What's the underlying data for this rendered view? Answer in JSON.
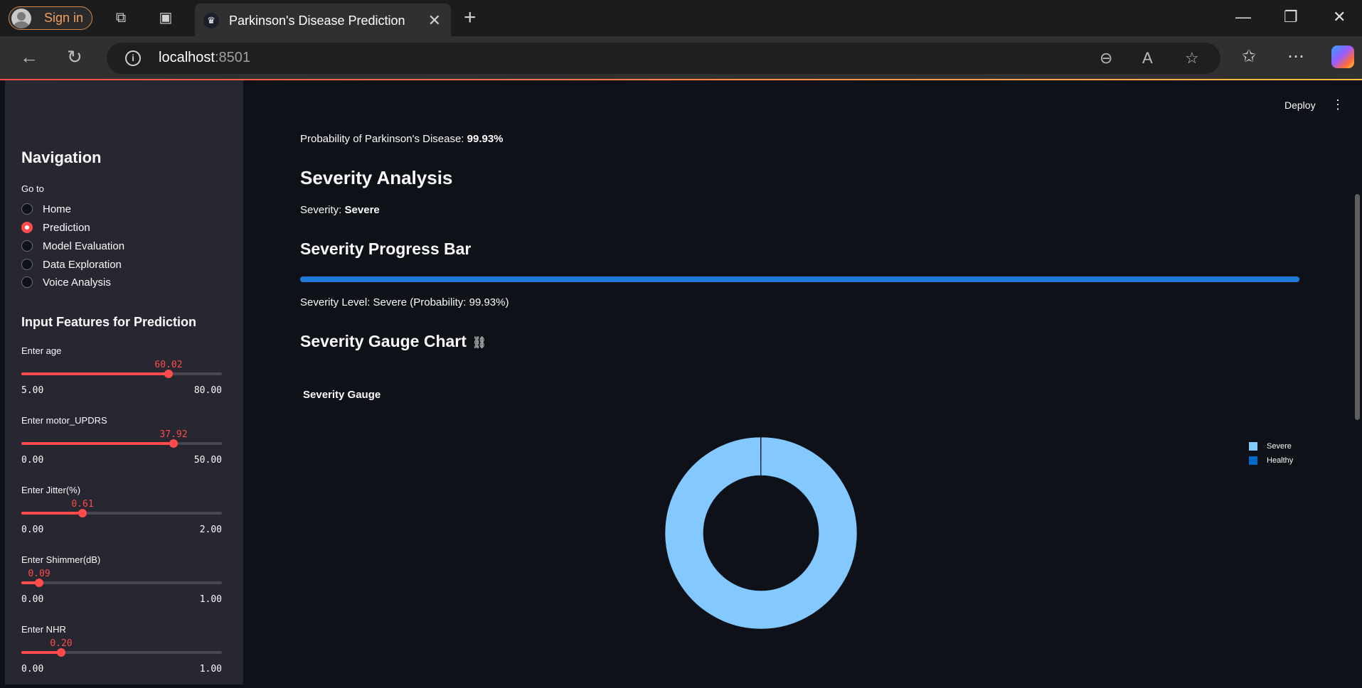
{
  "browser": {
    "signin_label": "Sign in",
    "tab_title": "Parkinson's Disease Prediction",
    "url_host": "localhost",
    "url_port": ":8501"
  },
  "sidebar": {
    "nav_title": "Navigation",
    "goto_label": "Go to",
    "nav_options": [
      {
        "label": "Home",
        "selected": false
      },
      {
        "label": "Prediction",
        "selected": true
      },
      {
        "label": "Model Evaluation",
        "selected": false
      },
      {
        "label": "Data Exploration",
        "selected": false
      },
      {
        "label": "Voice Analysis",
        "selected": false
      }
    ],
    "features_title": "Input Features for Prediction",
    "sliders": [
      {
        "label": "Enter age",
        "value": 60.02,
        "value_text": "60.02",
        "min": 5,
        "max": 80,
        "min_text": "5.00",
        "max_text": "80.00"
      },
      {
        "label": "Enter motor_UPDRS",
        "value": 37.92,
        "value_text": "37.92",
        "min": 0,
        "max": 50,
        "min_text": "0.00",
        "max_text": "50.00"
      },
      {
        "label": "Enter Jitter(%)",
        "value": 0.61,
        "value_text": "0.61",
        "min": 0,
        "max": 2,
        "min_text": "0.00",
        "max_text": "2.00"
      },
      {
        "label": "Enter Shimmer(dB)",
        "value": 0.09,
        "value_text": "0.09",
        "min": 0,
        "max": 1,
        "min_text": "0.00",
        "max_text": "1.00"
      },
      {
        "label": "Enter NHR",
        "value": 0.2,
        "value_text": "0.20",
        "min": 0,
        "max": 1,
        "min_text": "0.00",
        "max_text": "1.00"
      }
    ]
  },
  "header": {
    "deploy_label": "Deploy"
  },
  "main": {
    "probability_prefix": "Probability of Parkinson's Disease: ",
    "probability_value": "99.93%",
    "severity_analysis_title": "Severity Analysis",
    "severity_prefix": "Severity: ",
    "severity_value": "Severe",
    "progress_title": "Severity Progress Bar",
    "progress_fraction": 0.9993,
    "severity_level_text": "Severity Level: Severe (Probability: 99.93%)",
    "gauge_section_title": "Severity Gauge Chart"
  },
  "chart_data": {
    "type": "pie",
    "title": "Severity Gauge",
    "hole": true,
    "categories": [
      "Severe",
      "Healthy"
    ],
    "values": [
      99.93,
      0.07
    ],
    "colors": [
      "#83c9ff",
      "#0068c9"
    ],
    "legend_position": "top-right"
  }
}
